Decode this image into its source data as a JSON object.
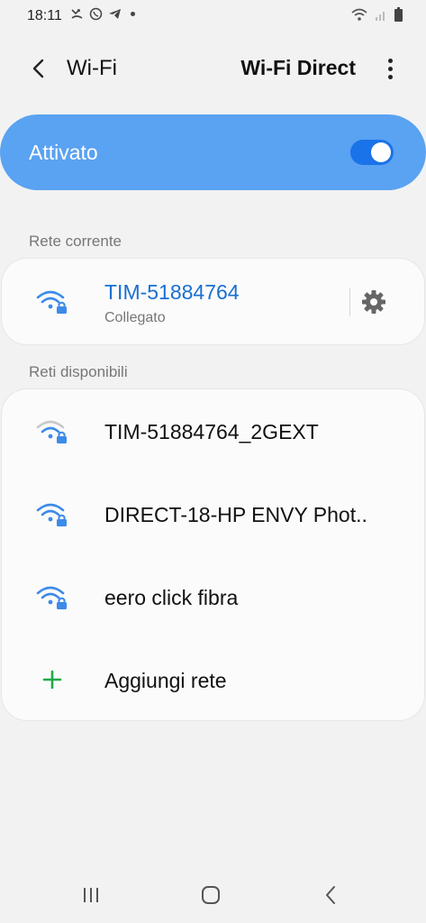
{
  "status_bar": {
    "time": "18:11",
    "icons": [
      "missed-call-icon",
      "whatsapp-icon",
      "telegram-icon",
      "notification-dot-icon",
      "wifi-icon",
      "signal-icon",
      "battery-icon"
    ]
  },
  "appbar": {
    "title": "Wi-Fi",
    "wifi_direct_label": "Wi-Fi Direct",
    "back_icon": "back-arrow-icon",
    "more_icon": "more-vert-icon"
  },
  "master": {
    "label": "Attivato",
    "enabled": true,
    "accent": "#5aa2f2"
  },
  "current_network": {
    "section_label": "Rete corrente",
    "ssid": "TIM-51884764",
    "status": "Collegato",
    "ssid_color": "#1a6fd0",
    "icon": "wifi-locked-icon",
    "settings_icon": "gear-icon"
  },
  "available": {
    "section_label": "Reti disponibili",
    "networks": [
      {
        "ssid": "TIM-51884764_2GEXT",
        "icon": "wifi-weak-locked-icon"
      },
      {
        "ssid": "DIRECT-18-HP ENVY Phot..",
        "icon": "wifi-locked-icon"
      },
      {
        "ssid": "eero click fibra",
        "icon": "wifi-locked-icon"
      }
    ],
    "add_label": "Aggiungi rete",
    "add_icon": "plus-icon",
    "add_color": "#1faa4a"
  },
  "navbar": {
    "icons": [
      "recent-apps-icon",
      "home-icon",
      "back-icon"
    ]
  }
}
